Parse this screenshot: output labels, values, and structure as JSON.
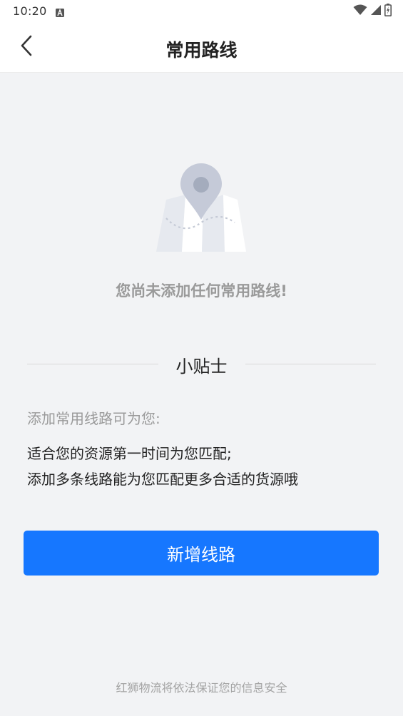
{
  "status_bar": {
    "time": "10:20",
    "icons": [
      "notification-a-icon",
      "wifi-icon",
      "signal-icon",
      "battery-charging-icon"
    ]
  },
  "nav": {
    "title": "常用路线",
    "back_icon": "chevron-left-icon"
  },
  "empty_state": {
    "illustration": "map-pin-illustration",
    "message": "您尚未添加任何常用路线!"
  },
  "tips": {
    "title": "小贴士",
    "intro": "添加常用线路可为您:",
    "line1": "适合您的资源第一时间为您匹配;",
    "line2": "添加多条线路能为您匹配更多合适的货源哦"
  },
  "actions": {
    "add_label": "新增线路"
  },
  "footer": {
    "text": "红狮物流将依法保证您的信息安全"
  },
  "colors": {
    "primary": "#1677ff",
    "background": "#f2f3f5",
    "muted_text": "#9a9a9a"
  }
}
